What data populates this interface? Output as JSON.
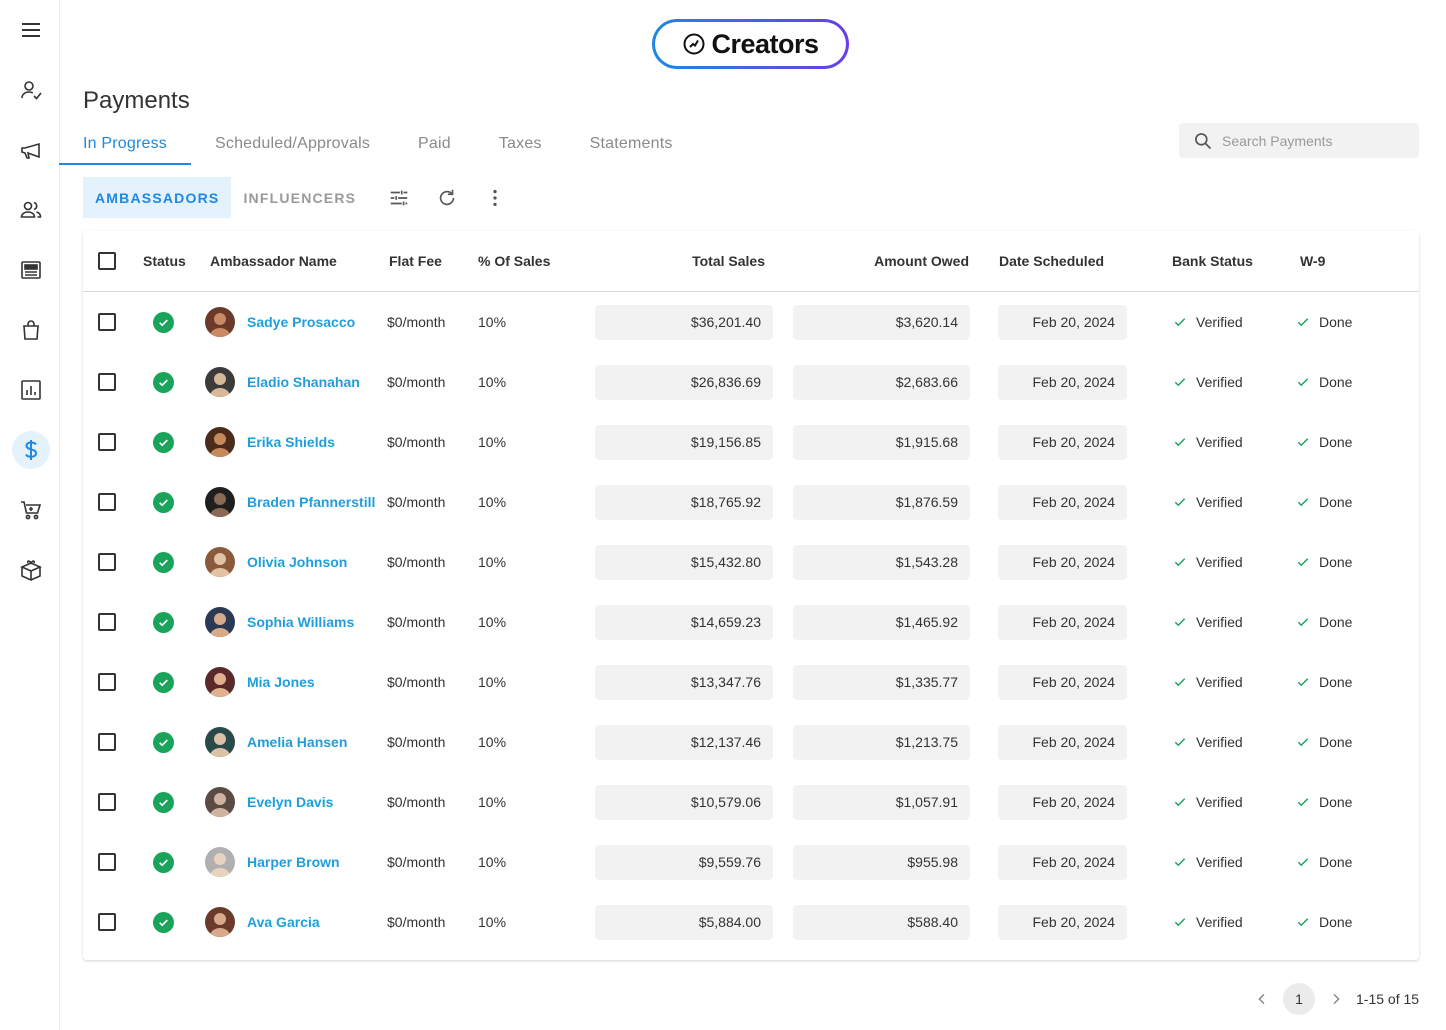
{
  "app": {
    "logo_text": "Creators"
  },
  "sidebar": {
    "items": [
      {
        "icon": "menu-icon"
      },
      {
        "icon": "person-check-icon"
      },
      {
        "icon": "megaphone-icon"
      },
      {
        "icon": "people-icon"
      },
      {
        "icon": "newspaper-icon"
      },
      {
        "icon": "shopping-bag-icon"
      },
      {
        "icon": "bar-chart-icon"
      },
      {
        "icon": "dollar-icon",
        "active": true
      },
      {
        "icon": "cart-icon"
      },
      {
        "icon": "gift-box-icon"
      }
    ]
  },
  "page": {
    "title": "Payments"
  },
  "tabs": [
    {
      "label": "In Progress",
      "active": true
    },
    {
      "label": "Scheduled/Approvals"
    },
    {
      "label": "Paid"
    },
    {
      "label": "Taxes"
    },
    {
      "label": "Statements"
    }
  ],
  "search": {
    "placeholder": "Search Payments",
    "value": ""
  },
  "toggle": {
    "ambassadors": "AMBASSADORS",
    "influencers": "INFLUENCERS",
    "active": "ambassadors"
  },
  "tools": [
    "filter-sliders-icon",
    "refresh-icon",
    "more-vertical-icon"
  ],
  "table": {
    "headers": {
      "status": "Status",
      "name": "Ambassador Name",
      "flat_fee": "Flat Fee",
      "pct_sales": "% Of Sales",
      "total_sales": "Total Sales",
      "amount_owed": "Amount Owed",
      "date_scheduled": "Date Scheduled",
      "bank_status": "Bank Status",
      "w9": "W-9"
    },
    "rows": [
      {
        "name": "Sadye Prosacco",
        "flat_fee": "$0/month",
        "pct": "10%",
        "total": "$36,201.40",
        "owed": "$3,620.14",
        "date": "Feb 20, 2024",
        "bank": "Verified",
        "w9": "Done"
      },
      {
        "name": "Eladio Shanahan",
        "flat_fee": "$0/month",
        "pct": "10%",
        "total": "$26,836.69",
        "owed": "$2,683.66",
        "date": "Feb 20, 2024",
        "bank": "Verified",
        "w9": "Done"
      },
      {
        "name": "Erika Shields",
        "flat_fee": "$0/month",
        "pct": "10%",
        "total": "$19,156.85",
        "owed": "$1,915.68",
        "date": "Feb 20, 2024",
        "bank": "Verified",
        "w9": "Done"
      },
      {
        "name": "Braden Pfannerstill",
        "flat_fee": "$0/month",
        "pct": "10%",
        "total": "$18,765.92",
        "owed": "$1,876.59",
        "date": "Feb 20, 2024",
        "bank": "Verified",
        "w9": "Done"
      },
      {
        "name": "Olivia Johnson",
        "flat_fee": "$0/month",
        "pct": "10%",
        "total": "$15,432.80",
        "owed": "$1,543.28",
        "date": "Feb 20, 2024",
        "bank": "Verified",
        "w9": "Done"
      },
      {
        "name": "Sophia Williams",
        "flat_fee": "$0/month",
        "pct": "10%",
        "total": "$14,659.23",
        "owed": "$1,465.92",
        "date": "Feb 20, 2024",
        "bank": "Verified",
        "w9": "Done"
      },
      {
        "name": "Mia Jones",
        "flat_fee": "$0/month",
        "pct": "10%",
        "total": "$13,347.76",
        "owed": "$1,335.77",
        "date": "Feb 20, 2024",
        "bank": "Verified",
        "w9": "Done"
      },
      {
        "name": "Amelia Hansen",
        "flat_fee": "$0/month",
        "pct": "10%",
        "total": "$12,137.46",
        "owed": "$1,213.75",
        "date": "Feb 20, 2024",
        "bank": "Verified",
        "w9": "Done"
      },
      {
        "name": "Evelyn Davis",
        "flat_fee": "$0/month",
        "pct": "10%",
        "total": "$10,579.06",
        "owed": "$1,057.91",
        "date": "Feb 20, 2024",
        "bank": "Verified",
        "w9": "Done"
      },
      {
        "name": "Harper Brown",
        "flat_fee": "$0/month",
        "pct": "10%",
        "total": "$9,559.76",
        "owed": "$955.98",
        "date": "Feb 20, 2024",
        "bank": "Verified",
        "w9": "Done"
      },
      {
        "name": "Ava Garcia",
        "flat_fee": "$0/month",
        "pct": "10%",
        "total": "$5,884.00",
        "owed": "$588.40",
        "date": "Feb 20, 2024",
        "bank": "Verified",
        "w9": "Done"
      }
    ]
  },
  "pagination": {
    "current_page": "1",
    "range": "1-15 of 15"
  },
  "colors": {
    "accent": "#1e88e5",
    "link": "#1e9fdc",
    "status_green": "#1aa35a",
    "active_bg": "#e3f2fb"
  }
}
